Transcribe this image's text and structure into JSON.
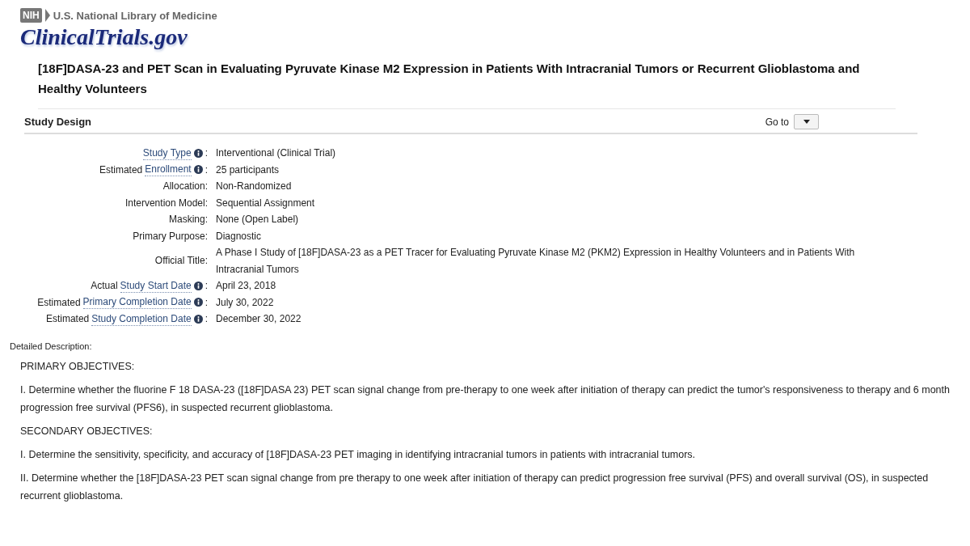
{
  "header": {
    "agency_badge": "NIH",
    "agency": "U.S. National Library of Medicine",
    "site": "ClinicalTrials.gov"
  },
  "study_title": "[18F]DASA-23 and PET Scan in Evaluating Pyruvate Kinase M2 Expression in Patients With Intracranial Tumors or Recurrent Glioblastoma and Healthy Volunteers",
  "section": {
    "title": "Study Design",
    "goto_label": "Go to"
  },
  "design_rows": [
    {
      "kind": "link",
      "prefix": "",
      "link": "Study Type",
      "separator": ":",
      "value": "Interventional  (Clinical Trial)"
    },
    {
      "kind": "link",
      "prefix": "Estimated",
      "link": "Enrollment",
      "separator": ":",
      "value": "25 participants"
    },
    {
      "kind": "plain",
      "label": "Allocation:",
      "value": "Non-Randomized"
    },
    {
      "kind": "plain",
      "label": "Intervention Model:",
      "value": "Sequential Assignment"
    },
    {
      "kind": "plain",
      "label": "Masking:",
      "value": "None (Open Label)"
    },
    {
      "kind": "plain",
      "label": "Primary Purpose:",
      "value": "Diagnostic"
    },
    {
      "kind": "plain",
      "label": "Official Title:",
      "value": "A Phase I Study of [18F]DASA-23 as a PET Tracer for Evaluating Pyruvate Kinase M2 (PKM2) Expression in Healthy Volunteers and in Patients With Intracranial Tumors"
    },
    {
      "kind": "link",
      "prefix": "Actual",
      "link": "Study Start Date",
      "separator": ":",
      "value": "April 23, 2018"
    },
    {
      "kind": "link",
      "prefix": "Estimated",
      "link": "Primary Completion Date",
      "separator": ":",
      "value": "July 30, 2022"
    },
    {
      "kind": "link",
      "prefix": "Estimated",
      "link": "Study Completion Date",
      "separator": ":",
      "value": "December 30, 2022"
    }
  ],
  "description": {
    "label": "Detailed Description:",
    "paragraphs": [
      "PRIMARY OBJECTIVES:",
      "I. Determine whether the fluorine F 18 DASA-23 ([18F]DASA 23) PET scan signal change from pre-therapy to one week after initiation of therapy can predict the tumor's responsiveness to therapy and 6 month progression free survival (PFS6), in suspected recurrent glioblastoma.",
      "SECONDARY OBJECTIVES:",
      "I. Determine the sensitivity, specificity, and accuracy of [18F]DASA-23 PET imaging in identifying intracranial tumors in patients with intracranial tumors.",
      "II. Determine whether the [18F]DASA-23 PET scan signal change from pre therapy to one week after initiation of therapy can predict progression free survival (PFS) and overall survival (OS), in suspected recurrent glioblastoma."
    ]
  }
}
